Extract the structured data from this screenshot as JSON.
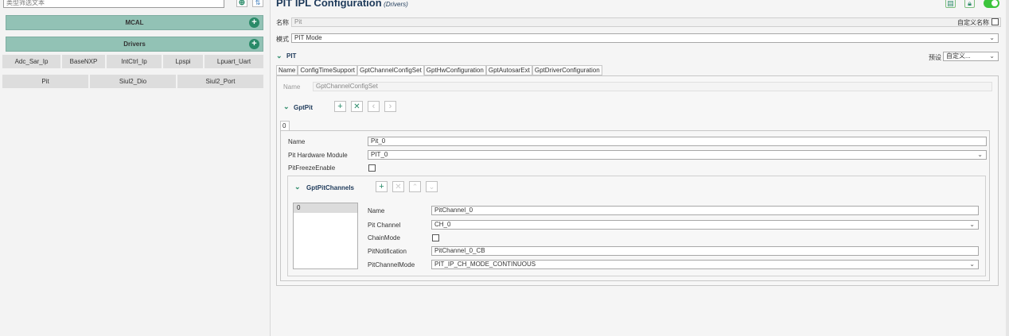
{
  "left": {
    "filter_placeholder": "类型筛选文本",
    "mcal_label": "MCAL",
    "drivers_label": "Drivers",
    "drivers_row1": [
      "Adc_Sar_Ip",
      "BaseNXP",
      "IntCtrl_Ip",
      "Lpspi",
      "Lpuart_Uart"
    ],
    "drivers_row2": [
      "Pit",
      "Siul2_Dio",
      "Siul2_Port"
    ]
  },
  "header": {
    "title": "PIT IPL Configuration",
    "subtitle": "(Drivers)",
    "name_label": "名称",
    "name_value": "Pit",
    "custom_name_label": "自定义名称",
    "mode_label": "模式",
    "mode_value": "PIT Mode",
    "section_label": "PIT",
    "preset_label": "预设",
    "preset_value": "自定义..."
  },
  "tabs": [
    "Name",
    "ConfigTimeSupport",
    "GptChannelConfigSet",
    "GptHwConfiguration",
    "GptAutosarExt",
    "GptDriverConfiguration"
  ],
  "channel_set": {
    "name_label": "Name",
    "name_value": "GptChannelConfigSet",
    "gptpit_label": "GptPit",
    "index_tab": "0",
    "name_field_label": "Name",
    "name_field_value": "Pit_0",
    "hw_module_label": "Pit Hardware Module",
    "hw_module_value": "PIT_0",
    "freeze_label": "PitFreezeEnable"
  },
  "channels": {
    "section_label": "GptPitChannels",
    "list_item": "0",
    "name_label": "Name",
    "name_value": "PitChannel_0",
    "channel_label": "Pit Channel",
    "channel_value": "CH_0",
    "chain_label": "ChainMode",
    "notification_label": "PitNotification",
    "notification_value": "PitChannel_0_CB",
    "mode_label": "PitChannelMode",
    "mode_value": "PIT_IP_CH_MODE_CONTINUOUS"
  },
  "colors": {
    "accent": "#2a8a68",
    "group_bg": "#92c2b5",
    "title": "#1e3a5a",
    "toggle": "#3cc43c"
  }
}
